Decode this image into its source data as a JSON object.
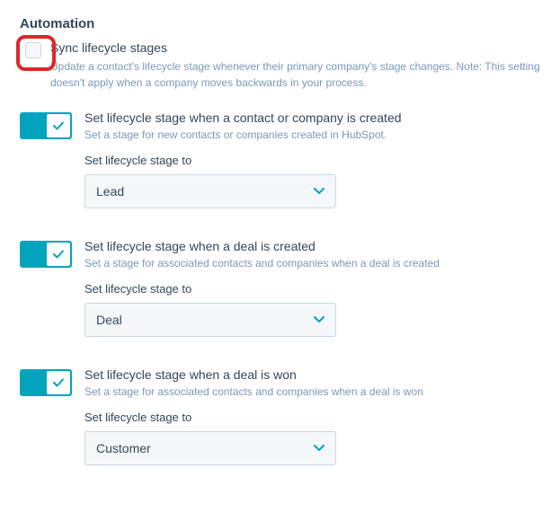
{
  "section_title": "Automation",
  "sync": {
    "label": "Sync lifecycle stages",
    "desc": "Update a contact's lifecycle stage whenever their primary company's stage changes. Note: This setting doesn't apply when a company moves backwards in your process."
  },
  "select_label": "Set lifecycle stage to",
  "settings": [
    {
      "title": "Set lifecycle stage when a contact or company is created",
      "desc": "Set a stage for new contacts or companies created in HubSpot.",
      "value": "Lead"
    },
    {
      "title": "Set lifecycle stage when a deal is created",
      "desc": "Set a stage for associated contacts and companies when a deal is created",
      "value": "Deal"
    },
    {
      "title": "Set lifecycle stage when a deal is won",
      "desc": "Set a stage for associated contacts and companies when a deal is won",
      "value": "Customer"
    }
  ],
  "colors": {
    "accent": "#00a4bd",
    "text": "#33475b",
    "muted": "#7c98b6",
    "marker": "#d9292a"
  }
}
